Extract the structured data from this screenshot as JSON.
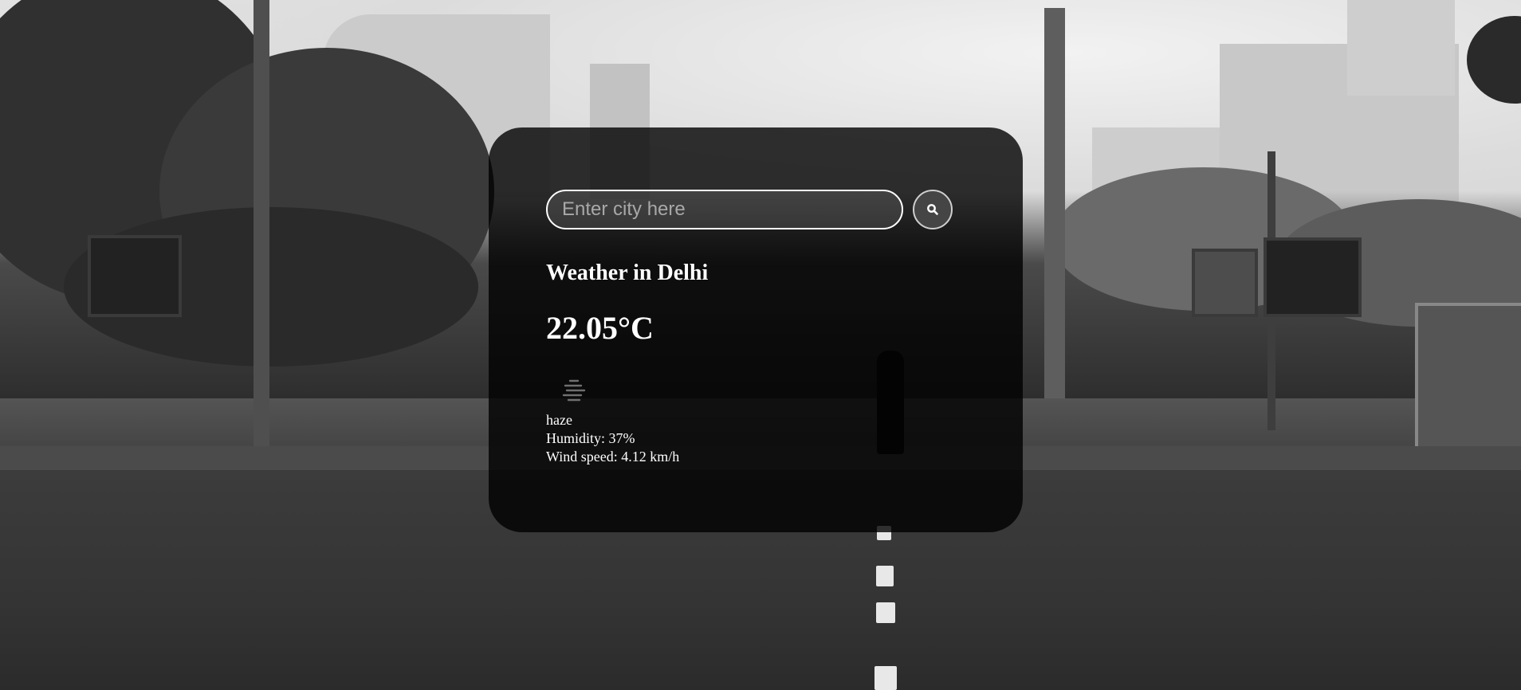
{
  "search": {
    "placeholder": "Enter city here",
    "value": "",
    "button_icon": "search-icon"
  },
  "weather": {
    "city_heading": "Weather in Delhi",
    "temperature": "22.05°C",
    "condition_icon": "haze-icon",
    "description": "haze",
    "humidity": "Humidity: 37%",
    "wind": "Wind speed: 4.12 km/h"
  },
  "colors": {
    "card_background": "#000000cc",
    "text": "#ffffff",
    "input_border": "#ffffff",
    "button_background": "#454545"
  }
}
